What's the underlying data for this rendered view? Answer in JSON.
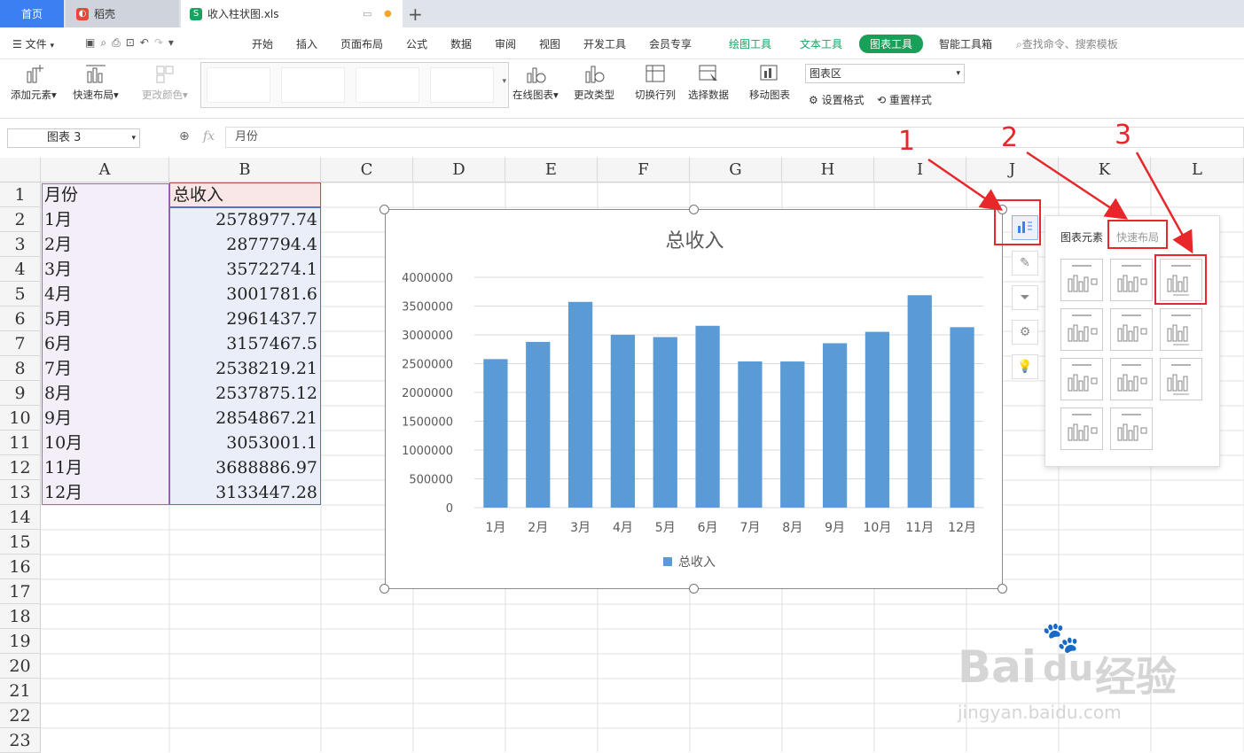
{
  "tabs": {
    "home": "首页",
    "daoke": "稻壳",
    "file": "收入柱状图.xls",
    "new_tab": "+"
  },
  "menu": {
    "file": "文件",
    "items": [
      "开始",
      "插入",
      "页面布局",
      "公式",
      "数据",
      "审阅",
      "视图",
      "开发工具",
      "会员专享"
    ],
    "draw_tools": "绘图工具",
    "text_tools": "文本工具",
    "chart_tools": "图表工具",
    "smart_tools": "智能工具箱",
    "search": "查找命令、搜索模板"
  },
  "ribbon": {
    "add_element": "添加元素",
    "quick_layout": "快速布局",
    "change_color": "更改颜色",
    "online_chart": "在线图表",
    "change_type": "更改类型",
    "switch_rowcol": "切换行列",
    "select_data": "选择数据",
    "move_chart": "移动图表",
    "chart_area_select": "图表区",
    "set_format": "设置格式",
    "reset_style": "重置样式"
  },
  "formula_bar": {
    "name_box": "图表 3",
    "fx": "fx",
    "content": "月份"
  },
  "sheet": {
    "columns": [
      "A",
      "B",
      "C",
      "D",
      "E",
      "F",
      "G",
      "H",
      "I",
      "J",
      "K",
      "L"
    ],
    "rows": [
      "1",
      "2",
      "3",
      "4",
      "5",
      "6",
      "7",
      "8",
      "9",
      "10",
      "11",
      "12",
      "13",
      "14",
      "15",
      "16",
      "17",
      "18",
      "19",
      "20",
      "21",
      "22",
      "23"
    ],
    "header_a": "月份",
    "header_b": "总收入",
    "months": [
      "1月",
      "2月",
      "3月",
      "4月",
      "5月",
      "6月",
      "7月",
      "8月",
      "9月",
      "10月",
      "11月",
      "12月"
    ],
    "values": [
      "2578977.74",
      "2877794.4",
      "3572274.1",
      "3001781.6",
      "2961437.7",
      "3157467.5",
      "2538219.21",
      "2537875.12",
      "2854867.21",
      "3053001.1",
      "3688886.97",
      "3133447.28"
    ]
  },
  "chart_data": {
    "type": "bar",
    "title": "总收入",
    "categories": [
      "1月",
      "2月",
      "3月",
      "4月",
      "5月",
      "6月",
      "7月",
      "8月",
      "9月",
      "10月",
      "11月",
      "12月"
    ],
    "series": [
      {
        "name": "总收入",
        "values": [
          2578977.74,
          2877794.4,
          3572274.1,
          3001781.6,
          2961437.7,
          3157467.5,
          2538219.21,
          2537875.12,
          2854867.21,
          3053001.1,
          3688886.97,
          3133447.28
        ]
      }
    ],
    "yticks": [
      "0",
      "500000",
      "1000000",
      "1500000",
      "2000000",
      "2500000",
      "3000000",
      "3500000",
      "4000000"
    ],
    "ylim": [
      0,
      4000000
    ],
    "grid": true,
    "legend": "bottom",
    "color": "#5b9bd5"
  },
  "panel": {
    "tab_elements": "图表元素",
    "tab_quick_layout": "快速布局"
  },
  "annotations": {
    "n1": "1",
    "n2": "2",
    "n3": "3",
    "color": "#e8272b"
  },
  "watermark": {
    "brand": "Bai",
    "brand2": "du",
    "cn": "经验",
    "url": "jingyan.baidu.com"
  }
}
